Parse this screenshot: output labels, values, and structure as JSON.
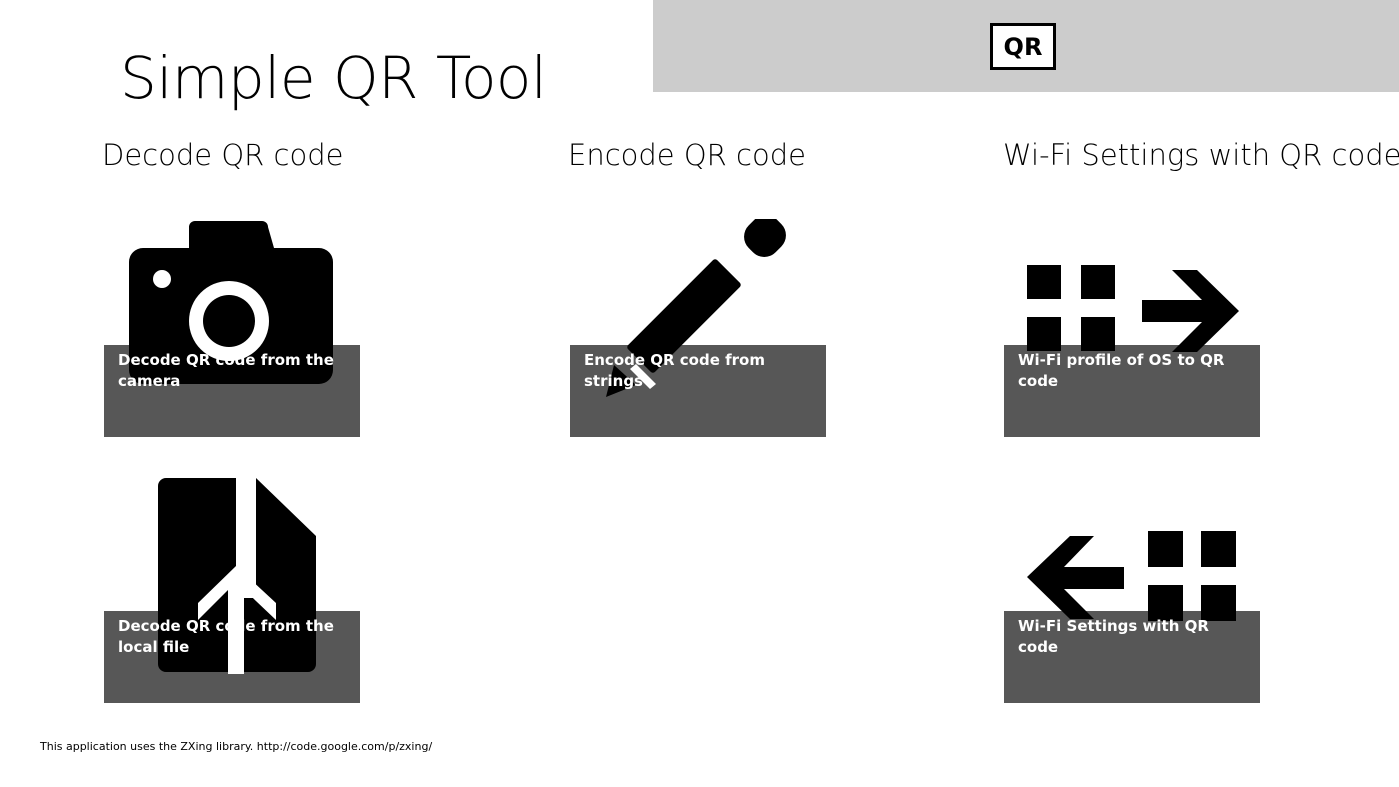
{
  "header": {
    "logo_text": "QR",
    "logo_icon": "qr-logo-icon"
  },
  "app": {
    "title": "Simple QR Tool"
  },
  "sections": [
    {
      "title": "Decode QR code"
    },
    {
      "title": "Encode QR code"
    },
    {
      "title": "Wi-Fi Settings with QR code"
    }
  ],
  "tiles": {
    "decode_camera": {
      "label": "Decode QR code from the camera",
      "icon": "camera-icon"
    },
    "decode_file": {
      "label": "Decode QR code from the local file",
      "icon": "file-upload-icon"
    },
    "encode_strings": {
      "label": "Encode QR code from strings",
      "icon": "pencil-icon"
    },
    "wifi_to_qr": {
      "label": "Wi-Fi profile of OS to QR code",
      "icon": "grid-arrow-right-icon"
    },
    "wifi_from_qr": {
      "label": "Wi-Fi Settings with QR code",
      "icon": "arrow-left-grid-icon"
    }
  },
  "colors": {
    "banner": "#cccccc",
    "tile": "#575757",
    "background": "#ffffff"
  },
  "footer": {
    "text": "This application uses the ZXing library. http://code.google.com/p/zxing/"
  }
}
